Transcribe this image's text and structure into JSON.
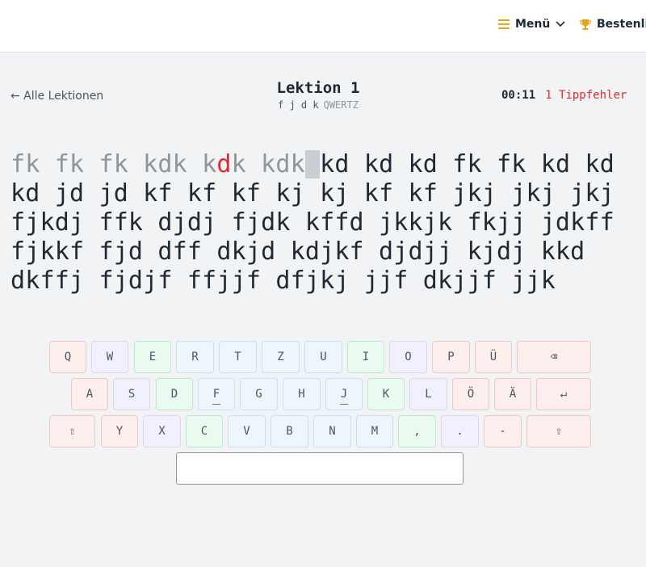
{
  "header": {
    "menu_label": "Menü",
    "leaderboard_label": "Bestenliste",
    "icons": {
      "menu": "hamburger-icon",
      "chevron": "chevron-down-icon",
      "leaderboard": "trophy-icon"
    },
    "accent_color": "#e8a31b"
  },
  "nav": {
    "back_link": "← Alle Lektionen"
  },
  "lesson": {
    "title": "Lektion 1",
    "keys": "f j d k",
    "layout": "QWERTZ"
  },
  "stats": {
    "timer": "00:11",
    "errors": "1 Tippfehler"
  },
  "text": {
    "typed_before_error": "fk fk fk kdk k",
    "error_char": "d",
    "typed_after_error": "k kdk",
    "cursor_char": " ",
    "line1_remaining": "kd kd kd fk fk kd kd",
    "lines": [
      "kd jd jd kf kf kf kj kj kf kf jkj jkj jkj",
      "fjkdj ffk djdj fjdk kffd jkkjk fkjj jdkff",
      "fjkkf fjd dff dkjd kdjkf djdjj kjdj kkd",
      "dkffj fjdjf ffjjf dfjkj jjf dkjjf jjk"
    ]
  },
  "keyboard": {
    "rows": [
      [
        "Q",
        "W",
        "E",
        "R",
        "T",
        "Z",
        "U",
        "I",
        "O",
        "P",
        "Ü",
        "⌫"
      ],
      [
        "A",
        "S",
        "D",
        "F",
        "G",
        "H",
        "J",
        "K",
        "L",
        "Ö",
        "Ä",
        "↵"
      ],
      [
        "⇧",
        "Y",
        "X",
        "C",
        "V",
        "B",
        "N",
        "M",
        ",",
        ".",
        "-",
        "⇧"
      ]
    ],
    "key_colors": {
      "red": "#fdeeee",
      "purple": "#f1f0fd",
      "green": "#ebfaf1",
      "blue": "#edf6fd"
    }
  },
  "input": {
    "value": ""
  }
}
